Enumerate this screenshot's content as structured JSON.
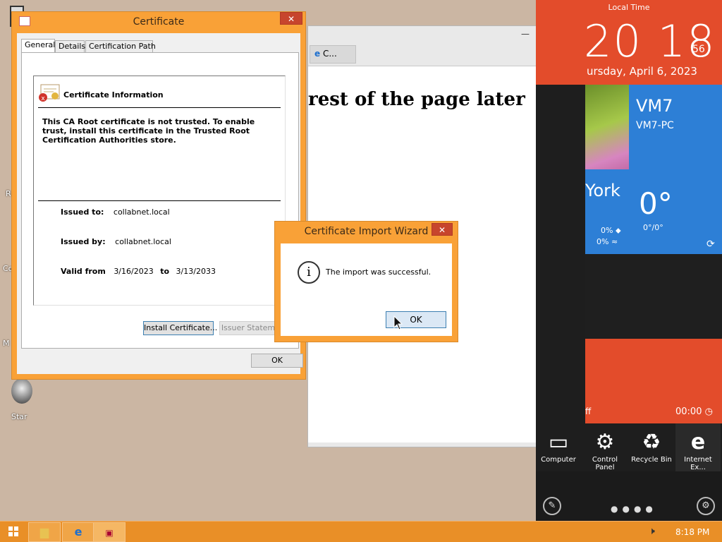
{
  "desktop": {
    "edge_labels": [
      "R",
      "Co",
      "M",
      "Star"
    ]
  },
  "browser": {
    "tab_label": "C...",
    "page_heading": "rest of the page later",
    "minimize": "—",
    "maximize": "☐",
    "close": "✕"
  },
  "certificate_dialog": {
    "title": "Certificate",
    "close": "✕",
    "tabs": [
      "General",
      "Details",
      "Certification Path"
    ],
    "info_title": "Certificate Information",
    "warning": "This CA Root certificate is not trusted. To enable trust, install this certificate in the Trusted Root Certification Authorities store.",
    "issued_to_label": "Issued to:",
    "issued_to": "collabnet.local",
    "issued_by_label": "Issued by:",
    "issued_by": "collabnet.local",
    "valid_from_label": "Valid from",
    "valid_from": "3/16/2023",
    "valid_to_label": "to",
    "valid_to": "3/13/2033",
    "install_button": "Install Certificate...",
    "issuer_statement_button": "Issuer Statement",
    "ok_button": "OK"
  },
  "import_wizard": {
    "title": "Certificate Import Wizard",
    "close": "✕",
    "message": "The import was successful.",
    "ok_button": "OK"
  },
  "tiles": {
    "local_time_label": "Local Time",
    "time": "20 18",
    "seconds": "56",
    "date": "ursday, April 6, 2023",
    "vm_name": "VM7",
    "vm_pc": "VM7-PC",
    "city": "York",
    "temp": "0°",
    "temp_range": "0°/0°",
    "precip": "0%",
    "wind": "0%",
    "red_text_partial": "ff",
    "timer": "00:00",
    "small_tiles": [
      {
        "label": "Computer",
        "icon": "computer-icon"
      },
      {
        "label": "Control Panel",
        "icon": "gear-icon"
      },
      {
        "label": "Recycle Bin",
        "icon": "recycle-bin-icon"
      },
      {
        "label": "Internet Ex...",
        "icon": "ie-icon"
      }
    ]
  },
  "taskbar": {
    "time": "8:18 PM"
  },
  "colors": {
    "orange_frame": "#f9a137",
    "tile_red": "#e34c2b",
    "tile_blue": "#2d7fd6",
    "taskbar": "#e98f27"
  }
}
